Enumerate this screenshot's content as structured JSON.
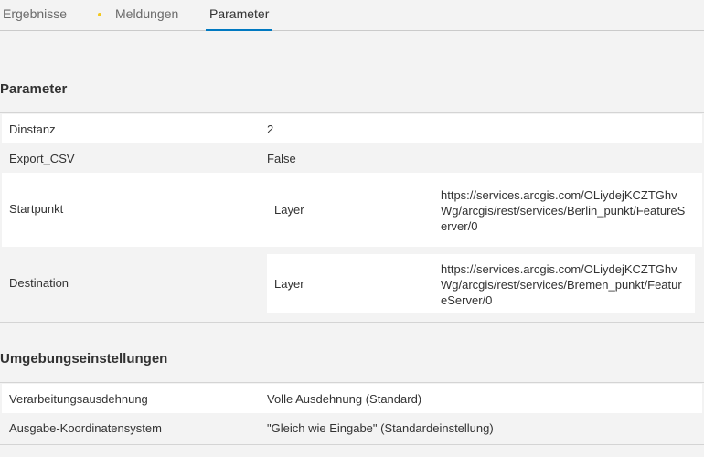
{
  "tabs": [
    {
      "label": "Ergebnisse"
    },
    {
      "label": "Meldungen"
    },
    {
      "label": "Parameter"
    }
  ],
  "parameters": {
    "title": "Parameter",
    "rows": [
      {
        "label": "Dinstanz",
        "value": "2"
      },
      {
        "label": "Export_CSV",
        "value": "False"
      },
      {
        "label": "Startpunkt",
        "type": "Layer",
        "url": "https://services.arcgis.com/OLiydejKCZTGhvWg/arcgis/rest/services/Berlin_punkt/FeatureServer/0"
      },
      {
        "label": "Destination",
        "type": "Layer",
        "url": "https://services.arcgis.com/OLiydejKCZTGhvWg/arcgis/rest/services/Bremen_punkt/FeatureServer/0"
      }
    ]
  },
  "environment": {
    "title": "Umgebungseinstellungen",
    "rows": [
      {
        "label": "Verarbeitungsausdehnung",
        "value": "Volle Ausdehnung (Standard)"
      },
      {
        "label": "Ausgabe-Koordinatensystem",
        "value": "\"Gleich wie Eingabe\" (Standardeinstellung)"
      }
    ]
  },
  "colors": {
    "accent": "#0079c1",
    "warning_dot": "#f3c81c"
  }
}
